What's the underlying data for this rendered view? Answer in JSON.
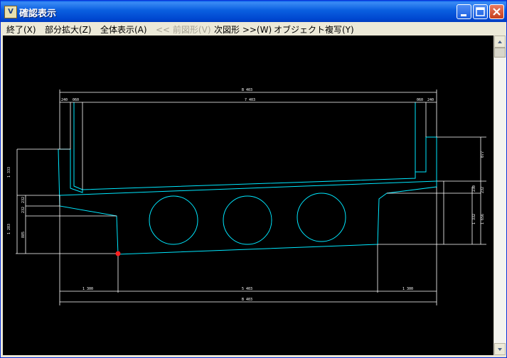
{
  "window": {
    "title": "確認表示"
  },
  "menu": [
    {
      "label": "終了(X)",
      "enabled": true
    },
    {
      "label": "部分拡大(Z)",
      "enabled": true
    },
    {
      "label": "全体表示(A)",
      "enabled": true
    },
    {
      "label": "<< 前図形(V)",
      "enabled": false
    },
    {
      "label": "次図形 >>(W)",
      "enabled": true
    },
    {
      "label": "オブジェクト複写(Y)",
      "enabled": true
    }
  ],
  "drawing": {
    "dimensions": {
      "top_total": "B 403",
      "top_inner": "7 403",
      "top_left_a": "240",
      "top_left_b": "060",
      "top_right_a": "060",
      "top_right_b": "240",
      "left_upper": "1 333",
      "left_mid": "232",
      "left_mid2": "232",
      "left_lower": "1 283",
      "left_lower2": "885",
      "right_upper": "077",
      "right_mid": "230",
      "right_mid2": "232",
      "right_lower": "1 332",
      "right_lower2": "1 656",
      "bottom_left": "1 300",
      "bottom_mid": "5 403",
      "bottom_right": "1 300",
      "bottom_total": "B 403"
    },
    "colors": {
      "outline": "#00e8ff",
      "dimension": "#ffffff",
      "marker": "#ff2020"
    }
  },
  "scrollbar": {
    "up_arrow": "up-arrow-icon",
    "down_arrow": "down-arrow-icon"
  }
}
